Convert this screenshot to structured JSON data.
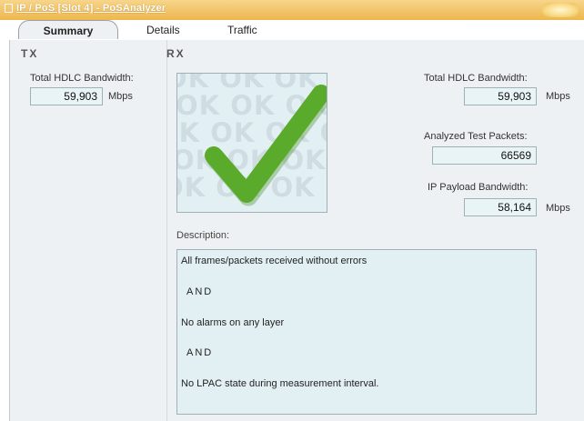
{
  "window": {
    "title": "IP / PoS [Slot 4] - PoSAnalyzer"
  },
  "tabs": [
    {
      "label": "Summary",
      "active": true
    },
    {
      "label": "Details",
      "active": false
    },
    {
      "label": "Traffic",
      "active": false
    }
  ],
  "tx": {
    "heading": "TX",
    "bandwidth_label": "Total HDLC Bandwidth:",
    "bandwidth_value": "59,903",
    "bandwidth_unit": "Mbps"
  },
  "rx": {
    "heading": "RX",
    "status_text": "OK",
    "bandwidth_label": "Total HDLC Bandwidth:",
    "bandwidth_value": "59,903",
    "bandwidth_unit": "Mbps",
    "packets_label": "Analyzed Test Packets:",
    "packets_value": "66569",
    "ip_payload_label": "IP Payload Bandwidth:",
    "ip_payload_value": "58,164",
    "ip_payload_unit": "Mbps",
    "description_label": "Description:",
    "description_lines": [
      "All frames/packets received without errors",
      "AND",
      "No alarms on any layer",
      "AND",
      "No LPAC state during measurement interval."
    ]
  },
  "colors": {
    "accent": "#eeb64e",
    "check": "#5aab2c"
  }
}
